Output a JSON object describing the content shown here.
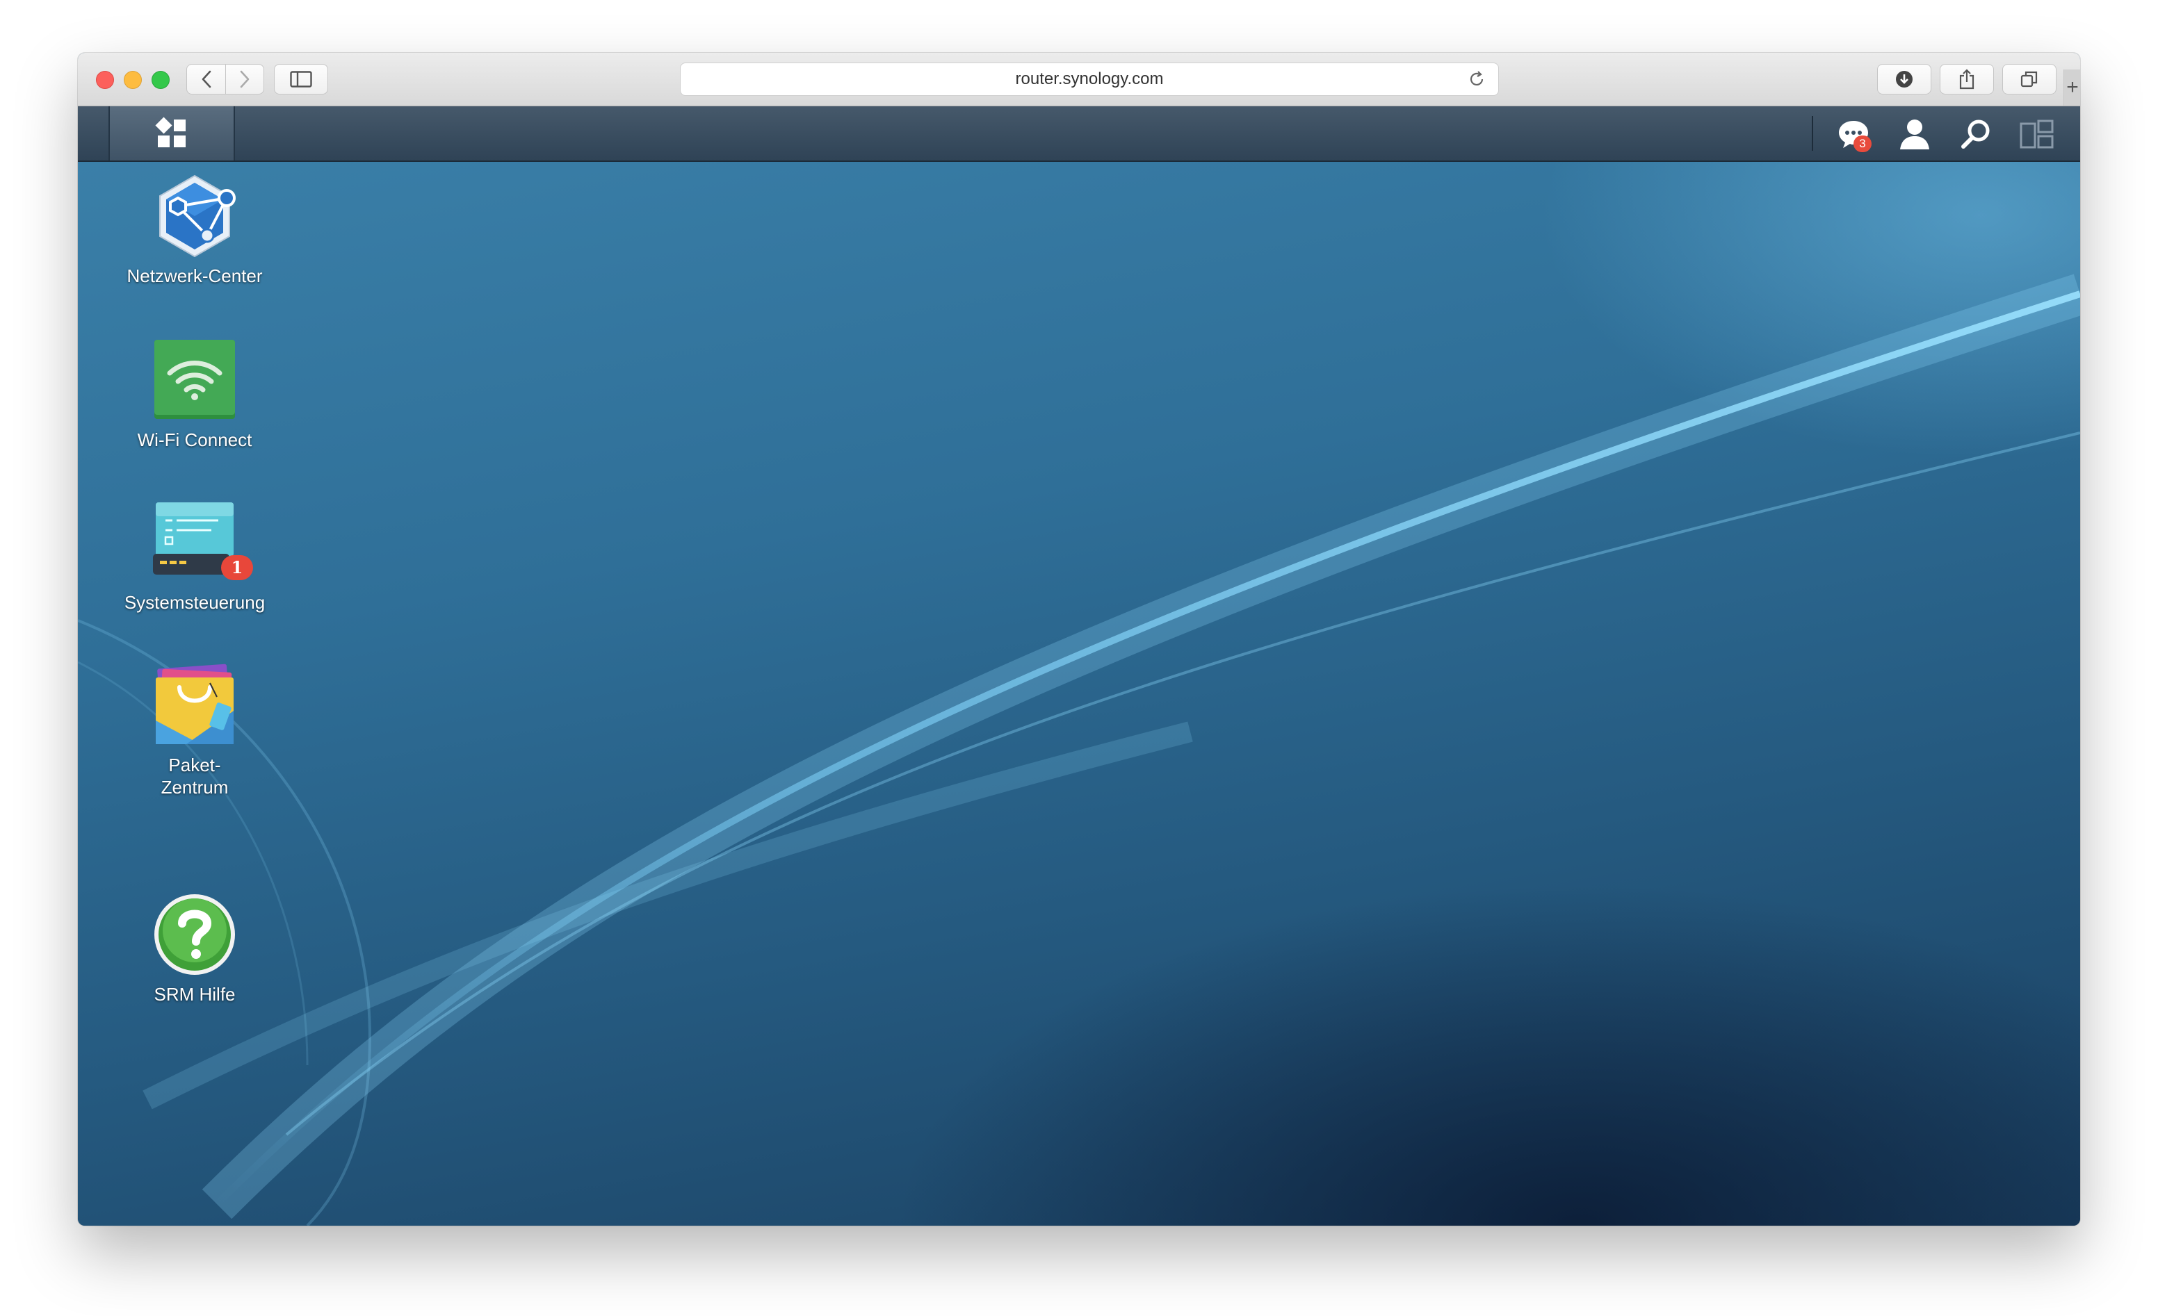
{
  "browser": {
    "url": "router.synology.com",
    "new_tab": "+"
  },
  "taskbar": {
    "notification_count": "3"
  },
  "desktop": {
    "apps": [
      {
        "label": "Netzwerk-Center",
        "icon": "network-center-icon"
      },
      {
        "label": "Wi-Fi Connect",
        "icon": "wifi-connect-icon"
      },
      {
        "label": "Systemsteuerung",
        "icon": "control-panel-icon",
        "badge": "1"
      },
      {
        "label": "Paket-\nZentrum",
        "icon": "package-center-icon"
      },
      {
        "label": "SRM Hilfe",
        "icon": "help-icon"
      }
    ]
  },
  "colors": {
    "accent": "#2f6f98",
    "badge": "#e84b3c",
    "taskbar": "#3a4e61"
  }
}
